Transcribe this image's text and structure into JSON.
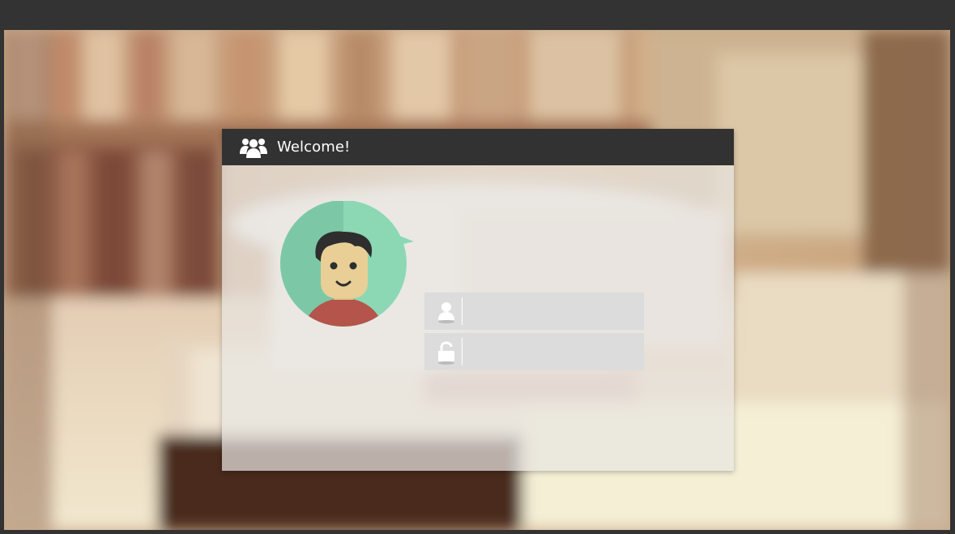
{
  "login": {
    "title": "Welcome!",
    "header_icon": "users-group-icon",
    "avatar_icon": "user-avatar-icon",
    "username": {
      "icon": "user-icon",
      "value": "",
      "placeholder": ""
    },
    "password": {
      "icon": "unlock-icon",
      "value": "",
      "placeholder": ""
    }
  },
  "colors": {
    "page_background": "#333333",
    "header_background": "#323232",
    "header_text": "#ffffff",
    "avatar_circle": "#8cd8b4",
    "avatar_shade": "#7cc8a6",
    "field_background": "#dcdcdc",
    "field_icon": "#ffffff"
  }
}
